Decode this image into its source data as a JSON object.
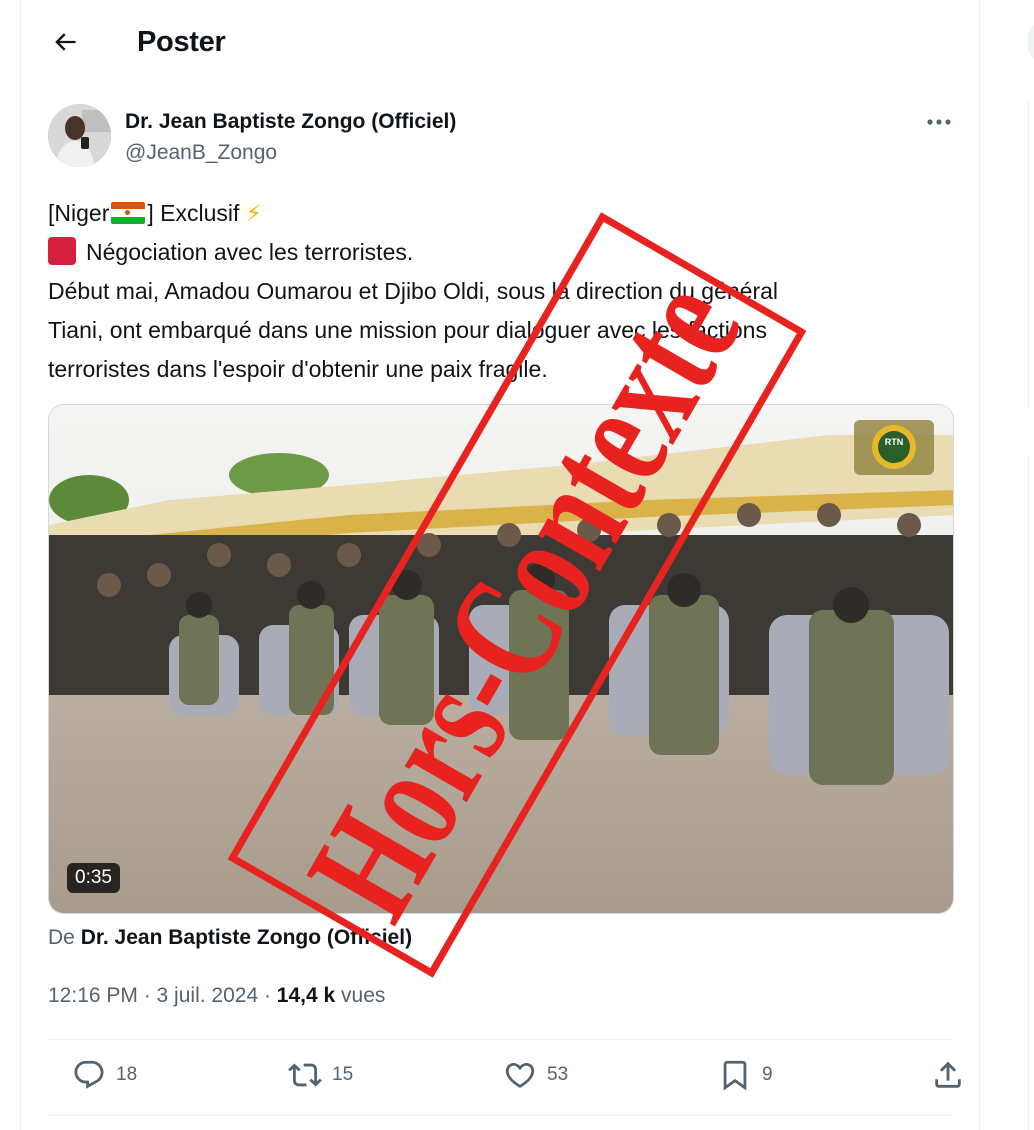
{
  "header": {
    "title": "Poster",
    "back_icon": "arrow-left-icon"
  },
  "tweet": {
    "author_name": "Dr. Jean Baptiste Zongo (Officiel)",
    "author_handle": "@JeanB_Zongo",
    "text": {
      "line1_a": "[Niger",
      "line1_b": "] Exclusif ",
      "line1_emoji": "⚡",
      "line2": "Négociation avec les terroristes.",
      "line3": "Début mai, Amadou Oumarou et Djibo Oldi, sous la direction du général",
      "line4": "Tiani, ont embarqué dans une mission pour dialoguer avec les factions",
      "line5": "terroristes dans l'espoir d'obtenir une paix fragile."
    },
    "video": {
      "duration": "0:35",
      "logo": "RTN"
    },
    "source_prefix": "De ",
    "source_name": "Dr. Jean Baptiste Zongo (Officiel)",
    "time": "12:16 PM · 3 juil. 2024 · ",
    "views_count": "14,4 k",
    "views_label": " vues"
  },
  "actions": {
    "replies": "18",
    "reposts": "15",
    "likes": "53",
    "bookmarks": "9"
  },
  "stamp": {
    "text": "Hors-Contexte",
    "color": "#e8231f"
  },
  "colors": {
    "text": "#0f1419",
    "muted": "#536471",
    "border": "#eff3f4"
  }
}
